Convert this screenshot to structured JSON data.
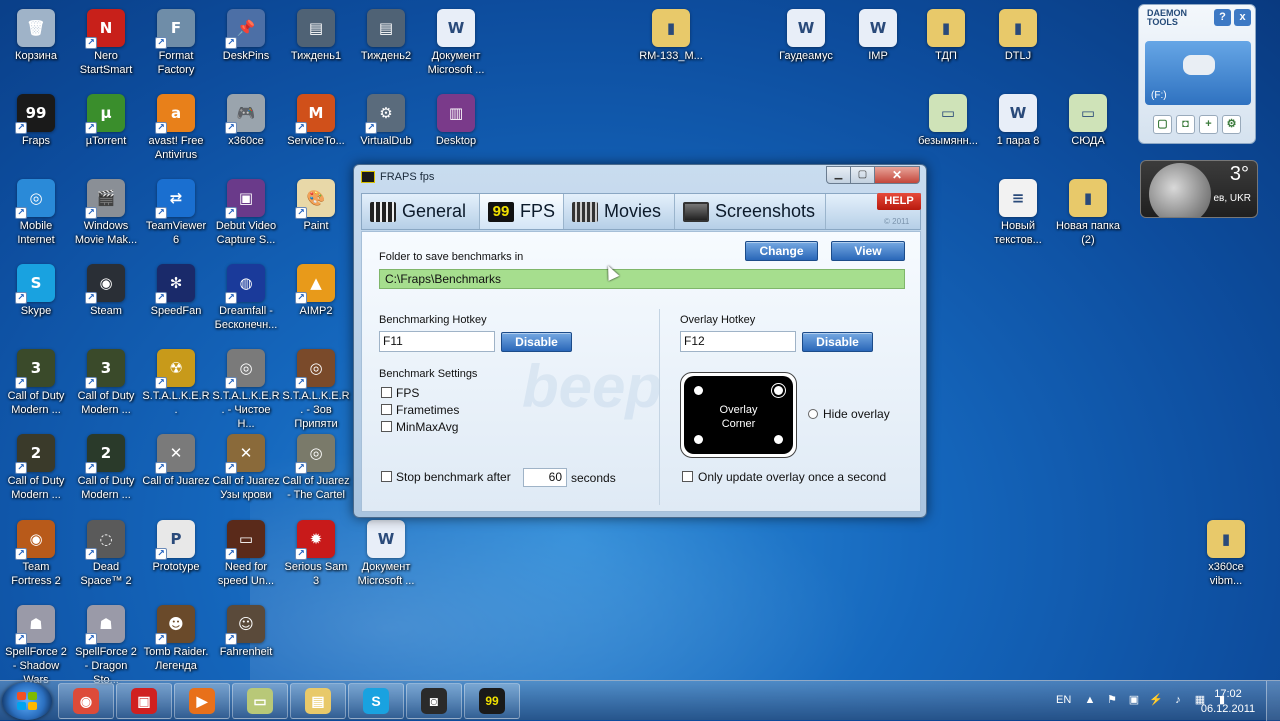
{
  "desktop_icons": [
    {
      "label": "Корзина",
      "icon": "recycle-bin-icon",
      "color": "#9fb3c8",
      "glyph": "🗑",
      "shortcut": false
    },
    {
      "label": "Nero StartSmart",
      "icon": "nero-icon",
      "color": "#c8201a",
      "glyph": "N",
      "shortcut": true
    },
    {
      "label": "Format Factory",
      "icon": "format-factory-icon",
      "color": "#6f8da8",
      "glyph": "F",
      "shortcut": true
    },
    {
      "label": "DeskPins",
      "icon": "deskpins-icon",
      "color": "#4c6fa6",
      "glyph": "📌",
      "shortcut": true
    },
    {
      "label": "Тиждень1",
      "icon": "document-icon",
      "color": "#4f6275",
      "glyph": "▤",
      "shortcut": false
    },
    {
      "label": "Тиждень2",
      "icon": "document-icon",
      "color": "#4f6275",
      "glyph": "▤",
      "shortcut": false
    },
    {
      "label": "Документ Microsoft ...",
      "icon": "word-document-icon",
      "color": "#e8eef8",
      "glyph": "W",
      "shortcut": false
    },
    {
      "label": "RM-133_M...",
      "icon": "folder-icon",
      "color": "#e8c96a",
      "glyph": "▮",
      "shortcut": false
    },
    {
      "label": "Гаудеамус",
      "icon": "word-document-icon",
      "color": "#e8eef8",
      "glyph": "W",
      "shortcut": false
    },
    {
      "label": "IMP",
      "icon": "word-document-icon",
      "color": "#e8eef8",
      "glyph": "W",
      "shortcut": false
    },
    {
      "label": "ТДП",
      "icon": "folder-icon",
      "color": "#e8c96a",
      "glyph": "▮",
      "shortcut": false
    },
    {
      "label": "DTLJ",
      "icon": "folder-icon",
      "color": "#e8c96a",
      "glyph": "▮",
      "shortcut": false
    },
    {
      "label": "Fraps",
      "icon": "fraps-icon",
      "color": "#1a1a1a",
      "glyph": "99",
      "shortcut": true
    },
    {
      "label": "µTorrent",
      "icon": "utorrent-icon",
      "color": "#3a8e2c",
      "glyph": "µ",
      "shortcut": true
    },
    {
      "label": "avast! Free Antivirus",
      "icon": "avast-icon",
      "color": "#e8801a",
      "glyph": "a",
      "shortcut": true
    },
    {
      "label": "x360ce",
      "icon": "gamepad-icon",
      "color": "#9aa4ad",
      "glyph": "🎮",
      "shortcut": true
    },
    {
      "label": "ServiceTo...",
      "icon": "servicetool-icon",
      "color": "#d0501a",
      "glyph": "M",
      "shortcut": true
    },
    {
      "label": "VirtualDub",
      "icon": "virtualdub-icon",
      "color": "#5a6b7c",
      "glyph": "⚙",
      "shortcut": true
    },
    {
      "label": "Desktop",
      "icon": "winrar-icon",
      "color": "#7a3a8a",
      "glyph": "▥",
      "shortcut": false
    },
    {
      "label": "безымянн...",
      "icon": "image-file-icon",
      "color": "#cfe3b8",
      "glyph": "▭",
      "shortcut": false
    },
    {
      "label": "1 пара 8",
      "icon": "word-document-icon",
      "color": "#e8eef8",
      "glyph": "W",
      "shortcut": false
    },
    {
      "label": "СЮДА",
      "icon": "image-file-icon",
      "color": "#cfe3b8",
      "glyph": "▭",
      "shortcut": false
    },
    {
      "label": "Mobile Internet",
      "icon": "mobile-internet-icon",
      "color": "#2a8ad8",
      "glyph": "◎",
      "shortcut": true
    },
    {
      "label": "Windows Movie Mak...",
      "icon": "movie-maker-icon",
      "color": "#8a8f96",
      "glyph": "🎬",
      "shortcut": true
    },
    {
      "label": "TeamViewer 6",
      "icon": "teamviewer-icon",
      "color": "#1a6fd0",
      "glyph": "⇄",
      "shortcut": true
    },
    {
      "label": "Debut Video Capture S...",
      "icon": "debut-icon",
      "color": "#6a3a8a",
      "glyph": "▣",
      "shortcut": true
    },
    {
      "label": "Paint",
      "icon": "paint-icon",
      "color": "#e8d8a8",
      "glyph": "🎨",
      "shortcut": true
    },
    {
      "label": "Новый текстов...",
      "icon": "text-file-icon",
      "color": "#f2f2f2",
      "glyph": "≡",
      "shortcut": false
    },
    {
      "label": "Новая папка (2)",
      "icon": "folder-icon",
      "color": "#e8c96a",
      "glyph": "▮",
      "shortcut": false
    },
    {
      "label": "Skype",
      "icon": "skype-icon",
      "color": "#19a2e0",
      "glyph": "S",
      "shortcut": true
    },
    {
      "label": "Steam",
      "icon": "steam-icon",
      "color": "#2a2f36",
      "glyph": "◉",
      "shortcut": true
    },
    {
      "label": "SpeedFan",
      "icon": "speedfan-icon",
      "color": "#1a2a6a",
      "glyph": "✻",
      "shortcut": true
    },
    {
      "label": "Dreamfall - Бесконечн...",
      "icon": "dreamfall-icon",
      "color": "#1a3a9a",
      "glyph": "◍",
      "shortcut": true
    },
    {
      "label": "AIMP2",
      "icon": "aimp-icon",
      "color": "#e89a1a",
      "glyph": "▲",
      "shortcut": true
    },
    {
      "label": "Call of Duty Modern ...",
      "icon": "cod-icon",
      "color": "#3a4a2a",
      "glyph": "3",
      "shortcut": true
    },
    {
      "label": "Call of Duty Modern ...",
      "icon": "cod-icon",
      "color": "#3a4a2a",
      "glyph": "3",
      "shortcut": true
    },
    {
      "label": "S.T.A.L.K.E.R.",
      "icon": "stalker-icon",
      "color": "#c89a1a",
      "glyph": "☢",
      "shortcut": true
    },
    {
      "label": "S.T.A.L.K.E.R. - Чистое Н...",
      "icon": "stalker-icon",
      "color": "#7a7a7a",
      "glyph": "◎",
      "shortcut": true
    },
    {
      "label": "S.T.A.L.K.E.R. - Зов Припяти",
      "icon": "stalker-icon",
      "color": "#7a4a2a",
      "glyph": "◎",
      "shortcut": true
    },
    {
      "label": "Call of Duty Modern ...",
      "icon": "cod-icon",
      "color": "#3a3a2a",
      "glyph": "2",
      "shortcut": true
    },
    {
      "label": "Call of Duty Modern ...",
      "icon": "cod-icon",
      "color": "#2a3a2a",
      "glyph": "2",
      "shortcut": true
    },
    {
      "label": "Call of Juarez",
      "icon": "coj-icon",
      "color": "#7a7a7a",
      "glyph": "✕",
      "shortcut": true
    },
    {
      "label": "Call of Juarez Узы крови",
      "icon": "coj-icon",
      "color": "#8a6a3a",
      "glyph": "✕",
      "shortcut": true
    },
    {
      "label": "Call of Juarez - The Cartel",
      "icon": "coj-icon",
      "color": "#7a7a6a",
      "glyph": "◎",
      "shortcut": true
    },
    {
      "label": "Team Fortress 2",
      "icon": "tf2-icon",
      "color": "#b85a1a",
      "glyph": "◉",
      "shortcut": true
    },
    {
      "label": "Dead Space™ 2",
      "icon": "deadspace-icon",
      "color": "#5a5a5a",
      "glyph": "◌",
      "shortcut": true
    },
    {
      "label": "Prototype",
      "icon": "prototype-icon",
      "color": "#e8e8e8",
      "glyph": "P",
      "shortcut": true
    },
    {
      "label": "Need for speed Un...",
      "icon": "nfs-icon",
      "color": "#5a2a1a",
      "glyph": "▭",
      "shortcut": true
    },
    {
      "label": "Serious Sam 3",
      "icon": "serious-sam-icon",
      "color": "#c81a1a",
      "glyph": "✹",
      "shortcut": true
    },
    {
      "label": "Документ Microsoft ...",
      "icon": "word-document-icon",
      "color": "#e8eef8",
      "glyph": "W",
      "shortcut": false
    },
    {
      "label": "x360ce vibm...",
      "icon": "folder-icon",
      "color": "#e8c96a",
      "glyph": "▮",
      "shortcut": false
    },
    {
      "label": "SpellForce 2 - Shadow Wars",
      "icon": "spellforce-icon",
      "color": "#9a9aa8",
      "glyph": "☗",
      "shortcut": true
    },
    {
      "label": "SpellForce 2 - Dragon Sto...",
      "icon": "spellforce-icon",
      "color": "#9a9aa8",
      "glyph": "☗",
      "shortcut": true
    },
    {
      "label": "Tomb Raider. Легенда",
      "icon": "tomb-raider-icon",
      "color": "#6a4a2a",
      "glyph": "☻",
      "shortcut": true
    },
    {
      "label": "Fahrenheit",
      "icon": "fahrenheit-icon",
      "color": "#5a4a3a",
      "glyph": "☺",
      "shortcut": true
    }
  ],
  "gadgets": {
    "daemon_title": "DAEMON TOOLS",
    "daemon_help": "?",
    "daemon_close": "x",
    "drive_label": "(F:)",
    "weather_temp": "3°",
    "weather_city": "ев, UKR"
  },
  "fraps": {
    "title": "FRAPS fps",
    "tabs": [
      {
        "label": "General",
        "icon": "general-tab-icon",
        "color": "#3a3a3a"
      },
      {
        "label": "FPS",
        "icon": "fps-99-icon",
        "color": "#f0e000"
      },
      {
        "label": "Movies",
        "icon": "film-strip-icon",
        "color": "#4a4a4a"
      },
      {
        "label": "Screenshots",
        "icon": "screenshot-icon",
        "color": "#5a5a5a"
      }
    ],
    "help_label": "HELP",
    "copyright": "© 2011",
    "folder_label": "Folder to save benchmarks in",
    "change_label": "Change",
    "view_label": "View",
    "folder_path": "C:\\Fraps\\Benchmarks",
    "bench_hotkey_label": "Benchmarking Hotkey",
    "bench_hotkey_value": "F11",
    "overlay_hotkey_label": "Overlay Hotkey",
    "overlay_hotkey_value": "F12",
    "disable_label": "Disable",
    "bench_settings_label": "Benchmark Settings",
    "opt_fps": "FPS",
    "opt_frametimes": "Frametimes",
    "opt_minmaxavg": "MinMaxAvg",
    "overlay_corner_line1": "Overlay",
    "overlay_corner_line2": "Corner",
    "hide_overlay_label": "Hide overlay",
    "stop_bench_label": "Stop benchmark after",
    "stop_bench_value": "60",
    "seconds_label": "seconds",
    "update_overlay_label": "Only update overlay once a second"
  },
  "taskbar": {
    "apps": [
      {
        "icon": "chrome-icon",
        "color": "#dd4b39",
        "glyph": "◉"
      },
      {
        "icon": "debut-capture-icon",
        "color": "#d02020",
        "glyph": "▣"
      },
      {
        "icon": "media-player-icon",
        "color": "#e8701a",
        "glyph": "▶"
      },
      {
        "icon": "notes-icon",
        "color": "#b8c878",
        "glyph": "▭"
      },
      {
        "icon": "explorer-icon",
        "color": "#e8c96a",
        "glyph": "▤"
      },
      {
        "icon": "skype-icon",
        "color": "#19a2e0",
        "glyph": "S"
      },
      {
        "icon": "camera-icon",
        "color": "#2a2a2a",
        "glyph": "◙"
      },
      {
        "icon": "fraps-icon",
        "color": "#1a1a1a",
        "glyph": "99"
      }
    ],
    "lang": "EN",
    "time": "17:02",
    "date": "06.12.2011"
  }
}
